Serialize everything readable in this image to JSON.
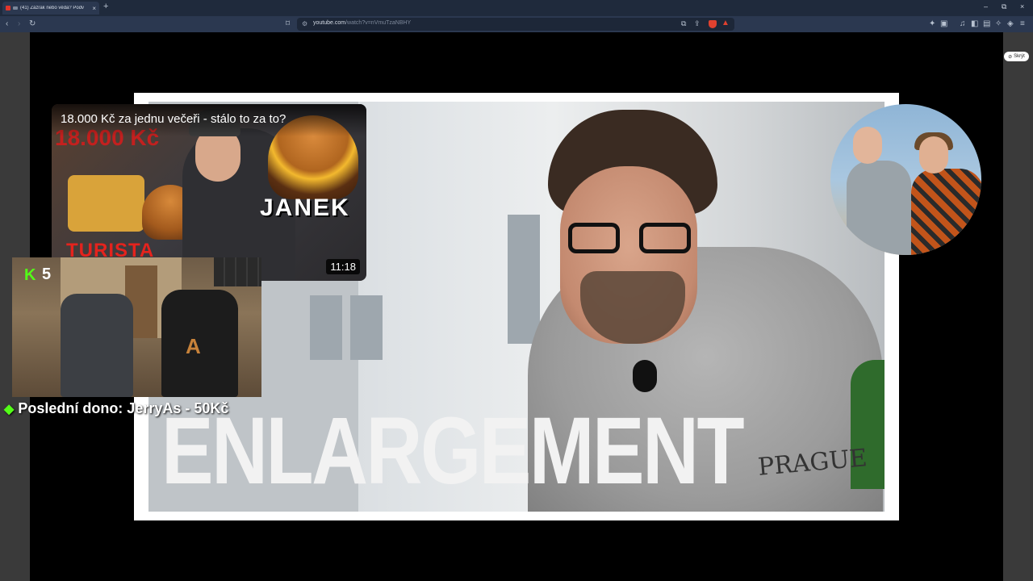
{
  "browser": {
    "tab_title": "(41) Zázrak nebo věda? Podv",
    "new_tab_label": "+",
    "tab_close": "×",
    "url_host": "youtube.com",
    "url_path": "/watch?v=nVmuTzaNBHY",
    "window_controls": [
      "–",
      "⧉",
      "×"
    ]
  },
  "player": {
    "hide_button_label": "Skrýt"
  },
  "thumbnail": {
    "headline": "ENLARGEMENT",
    "shirt_text": "PRAGUE"
  },
  "suggested_video": {
    "title": "18.000 Kč za jednu večeři - stálo to za to?",
    "background_price": "18.000 Kč",
    "label_right": "JANEK",
    "label_left": "TURISTA",
    "duration": "11:18"
  },
  "stream_overlay": {
    "kick_count": "5",
    "last_donation": "Poslední dono: JerryAs - 50Kč"
  },
  "colors": {
    "browser_chrome": "#2b3850",
    "kick_green": "#53fc18",
    "youtube_red": "#e0352b"
  }
}
